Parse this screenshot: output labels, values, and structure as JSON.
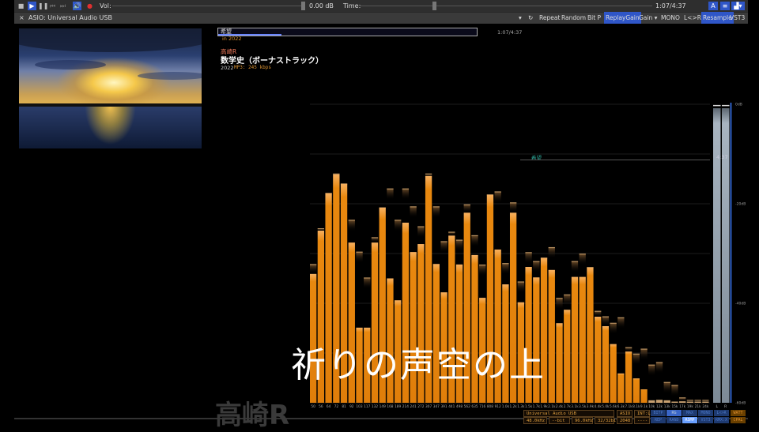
{
  "toolbar": {
    "vol_label": "Vol:",
    "volume_value": "0.00 dB",
    "volume_level": 0.99,
    "time_label": "Time:",
    "time_position": 0.245,
    "time_value": "1:07/4:37"
  },
  "output": {
    "close": "×",
    "device": "ASIO: Universal Audio USB",
    "buttons": [
      "Repeat",
      "Random",
      "Bit P",
      "ReplayGain",
      "Gain ▾",
      "MONO",
      "L<>R",
      "Resample",
      "VST3"
    ],
    "active": [
      "ReplayGain",
      "Resample"
    ]
  },
  "track": {
    "search_text": "希望",
    "search_progress": 0.24,
    "time": "1:07/4:37",
    "year_note": "in 2022",
    "artist": "高崎R",
    "title": "数学史（ボーナストラック）",
    "year": "2022",
    "format": "MP3: 245 kbps"
  },
  "lyric": "祈りの声空の上",
  "watermark": "高崎R",
  "marker": {
    "label": "希望",
    "time": "4:37"
  },
  "chart_data": {
    "type": "bar",
    "title": "Spectrum",
    "categories": [
      "50",
      "56",
      "64",
      "72",
      "81",
      "92",
      "103",
      "117",
      "132",
      "149",
      "168",
      "189",
      "214",
      "241",
      "272",
      "307",
      "347",
      "391",
      "441",
      "498",
      "562",
      "635",
      "716",
      "808",
      "912",
      "1.0k",
      "1.2k",
      "1.3k",
      "1.5k",
      "1.7k",
      "1.9k",
      "2.1k",
      "2.4k",
      "2.7k",
      "3.1k",
      "3.5k",
      "3.9k",
      "4.4k",
      "5.0k",
      "5.6k",
      "6.3k",
      "7.1k",
      "8.1k",
      "9.1k",
      "10k",
      "12k",
      "13k",
      "15k",
      "17k",
      "19k",
      "21k",
      "24k"
    ],
    "values": [
      -34.1,
      -25.4,
      -17.9,
      -14.1,
      -16,
      -27.8,
      -44.9,
      -44.9,
      -27.8,
      -20.8,
      -35,
      -39.4,
      -23.8,
      -29.7,
      -28.1,
      -14.4,
      -32.1,
      -37.8,
      -26.4,
      -32.2,
      -21.8,
      -30.3,
      -38.9,
      -18.2,
      -29.2,
      -36.2,
      -21.8,
      -39.8,
      -32.7,
      -34.8,
      -30.9,
      -33.3,
      -44,
      -41.3,
      -34.7,
      -34.7,
      -32.8,
      -42.7,
      -44.6,
      -48.2,
      -54.1,
      -49.7,
      -55.1,
      -57.3,
      -59.5,
      -59.4,
      -59.5,
      -59.8,
      -59.7,
      -59.8,
      -59.8,
      -59.8
    ],
    "peaks": [
      -32.2,
      -25,
      -17.9,
      -14,
      -16,
      -23.3,
      -29.7,
      -34.9,
      -26.8,
      -20.8,
      -17,
      -23.3,
      -17,
      -20.6,
      -24.6,
      -14,
      -20.6,
      -27.6,
      -25.7,
      -27.3,
      -20.2,
      -26.4,
      -32.3,
      -18.2,
      -17.6,
      -32,
      -19.8,
      -35.7,
      -29.8,
      -31.6,
      -30.9,
      -28.8,
      -39,
      -38.3,
      -31.6,
      -30.1,
      -32.8,
      -41.6,
      -42.7,
      -44,
      -42.9,
      -48.9,
      -50.2,
      -49.2,
      -52.4,
      -51.9,
      -55.9,
      -56.5,
      -59,
      -59.5,
      -59.5,
      -59.5
    ],
    "meters": {
      "labels": [
        "L",
        "R"
      ],
      "values": [
        -0.8,
        -0.8
      ],
      "peaks": [
        -0.3,
        -0.3
      ]
    },
    "ylim": [
      -60,
      0
    ],
    "yticks": [
      "0dB",
      "-20dB",
      "-40dB",
      "-60dB"
    ],
    "grid": true,
    "bar_color": "#e8880f"
  },
  "status": {
    "device": "Universal Audio USB",
    "mode": "ASIO",
    "int": "INT:L",
    "rate_in": "48.0kHz",
    "bits": "--bit",
    "rate_out": "96.0kHz",
    "bitdepth": "32/32bit",
    "buffer": "2048",
    "misc": "----",
    "row1": [
      "BITP",
      "RG",
      "MAX",
      "MONO",
      "L<>R"
    ],
    "row2": [
      "REP",
      "RAND",
      "RSMP",
      "VST3",
      "RMX:X"
    ],
    "watt": "WATT",
    "cpal": "CPAL"
  }
}
